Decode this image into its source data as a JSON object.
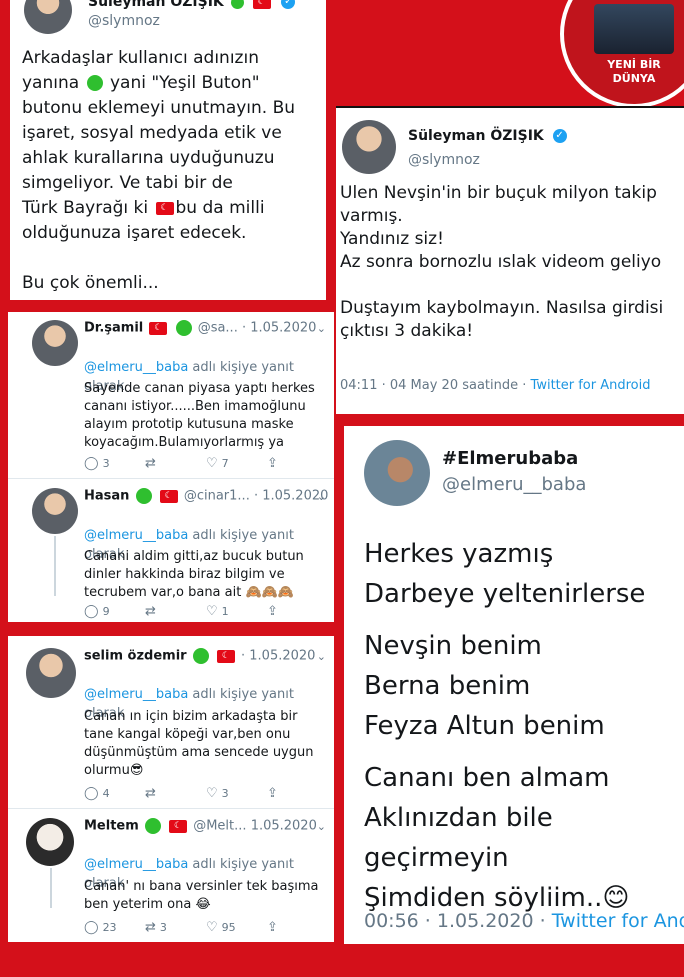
{
  "card1": {
    "name": "Süleyman ÖZIŞIK",
    "handle": "@slymnoz",
    "text_lines": [
      "Arkadaşlar kullanıcı adınızın",
      "yanına ",
      " yani \"Yeşil Buton\"",
      "butonu eklemeyi unutmayın. Bu",
      "işaret, sosyal medyada etik ve",
      "ahlak kurallarına uyduğunuzu",
      "simgeliyor. Ve tabi bir de",
      "Türk Bayrağı ki ",
      "bu da milli",
      "olduğunuza işaret edecek.",
      "",
      "Bu çok önemli..."
    ]
  },
  "badge": {
    "line1": "YENİ BİR",
    "line2": "DÜNYA"
  },
  "card2": {
    "name": "Süleyman ÖZIŞIK",
    "handle": "@slymnoz",
    "text": "Ulen Nevşin'in bir buçuk milyon takip\nvarmış.\nYandınız siz!\nAz sonra bornozlu ıslak videom geliyo\n\nDuştayım kaybolmayın. Nasılsa girdisi\nçıktısı 3 dakika!",
    "time": "04:11 · 04 May 20 saatinde · ",
    "source": "Twitter for Android"
  },
  "replies_a": [
    {
      "name": "Dr.şamil",
      "handle": "@sa...",
      "date": "· 1.05.2020",
      "reply_to": "@elmeru__baba",
      "reply_suffix": " adlı kişiye yanıt\nolarak",
      "text": "Sayende canan piyasa yaptı herkes\ncananı istiyor......Ben imamoğlunu\nalayım prototip kutusuna maske\nkoyacağım.Bulamıyorlarmış ya",
      "replies": "3",
      "retweets": "",
      "likes": "7"
    },
    {
      "name": "Hasan",
      "handle": "@cinar1...",
      "date": "· 1.05.2020",
      "reply_to": "@elmeru__baba",
      "reply_suffix": " adlı kişiye yanıt\nolarak",
      "text": "Canani aldim gitti,az bucuk butun\ndinler hakkinda biraz bilgim ve\ntecrubem var,o bana ait 🙈🙈🙈",
      "replies": "9",
      "retweets": "",
      "likes": "1"
    }
  ],
  "replies_b": [
    {
      "name": "selim özdemir",
      "handle": "",
      "date": "· 1.05.2020",
      "reply_to": "@elmeru__baba",
      "reply_suffix": " adlı kişiye yanıt\nolarak",
      "text": "Canan ın için bizim arkadaşta bir\ntane kangal köpeği var,ben onu\ndüşünmüştüm ama sencede uygun\nolurmu😎",
      "replies": "4",
      "retweets": "",
      "likes": "3"
    },
    {
      "name": "Meltem",
      "handle": "@Melt...",
      "date": "1.05.2020",
      "reply_to": "@elmeru__baba",
      "reply_suffix": " adlı kişiye yanıt\nolarak",
      "text": "Canan' nı bana versinler tek başıma\nben yeterim ona 😂",
      "replies": "23",
      "retweets": "3",
      "likes": "95"
    }
  ],
  "card3": {
    "name": "#Elmerubaba",
    "handle": "@elmeru__baba",
    "lines": [
      "Herkes yazmış",
      "Darbeye yeltenirlerse",
      "",
      "Nevşin benim",
      "Berna benim",
      "Feyza Altun benim",
      "",
      "Cananı ben almam",
      "Aklınızdan bile geçirmeyin",
      "Şimdiden söyliim..😊"
    ],
    "time": "00:56 · 1.05.2020 · ",
    "source": "Twitter for And"
  },
  "icons": {
    "reply": "reply-icon",
    "retweet": "retweet-icon",
    "like": "heart-icon",
    "share": "share-icon",
    "verified": "verified-badge-icon",
    "chevron": "chevron-down-icon"
  },
  "colors": {
    "background": "#d4101a",
    "link": "#1b95e0",
    "green_button": "#2fbf2f"
  }
}
